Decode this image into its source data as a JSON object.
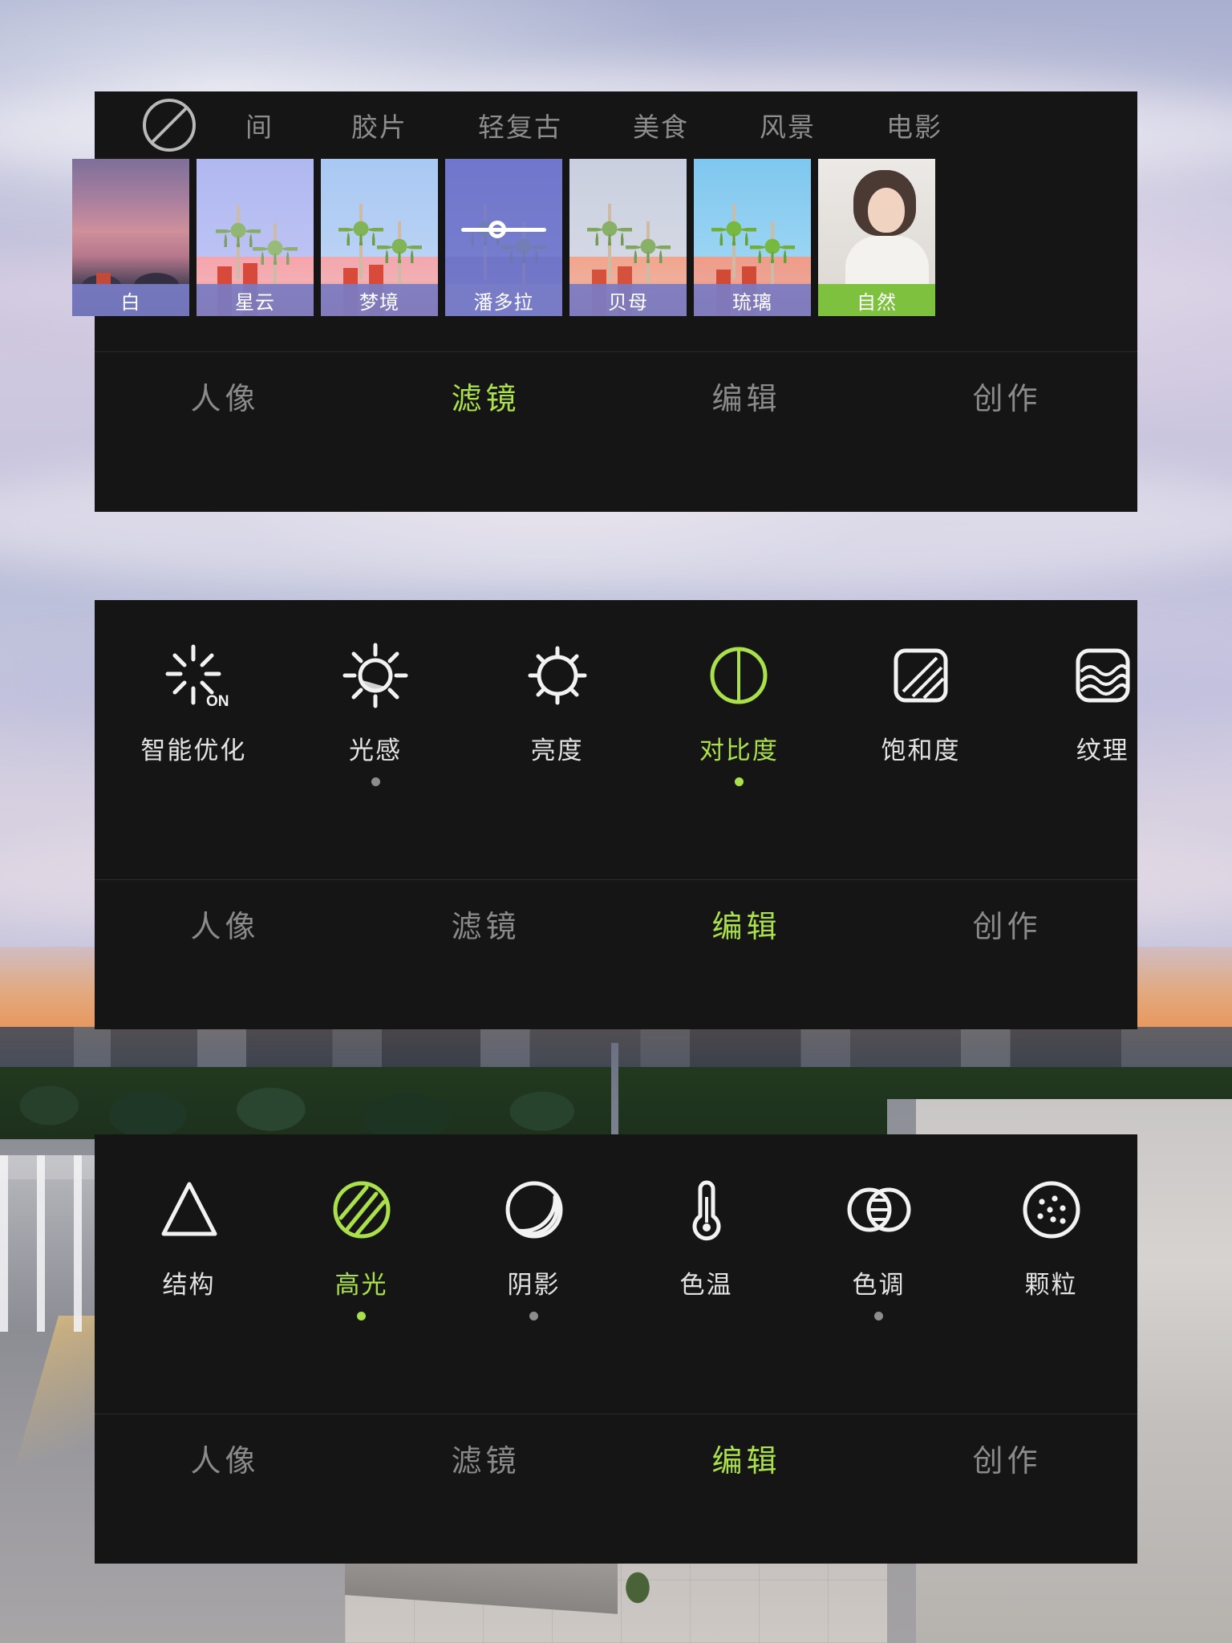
{
  "app": {
    "accent_green": "#a9e04c",
    "panel_bg": "#151515",
    "caption_violet": "#787cc4",
    "caption_green": "#7ec13f",
    "inactive_text": "#8a8a8a"
  },
  "filter_panel": {
    "no_filter_icon": "circle-slash-icon",
    "clipped_tab": "间",
    "category_tabs": [
      {
        "label": "胶片",
        "active": false
      },
      {
        "label": "轻复古",
        "active": false
      },
      {
        "label": "美食",
        "active": false
      },
      {
        "label": "风景",
        "active": false
      },
      {
        "label": "电影",
        "active": false
      }
    ],
    "filters": [
      {
        "label": "白",
        "selected": false,
        "clipped": true,
        "style": "sunset",
        "caption_style": "violet"
      },
      {
        "label": "星云",
        "selected": false,
        "clipped": false,
        "style": "palm-a",
        "caption_style": "violet"
      },
      {
        "label": "梦境",
        "selected": false,
        "clipped": false,
        "style": "palm-b",
        "caption_style": "violet"
      },
      {
        "label": "潘多拉",
        "selected": true,
        "clipped": false,
        "style": "palm-c",
        "caption_style": "violet"
      },
      {
        "label": "贝母",
        "selected": false,
        "clipped": false,
        "style": "palm-d",
        "caption_style": "violet"
      },
      {
        "label": "琉璃",
        "selected": false,
        "clipped": false,
        "style": "palm-e",
        "caption_style": "violet"
      },
      {
        "label": "自然",
        "selected": false,
        "clipped": true,
        "style": "portrait",
        "caption_style": "green"
      }
    ],
    "slider_value_percent": 40,
    "navbar": [
      {
        "label": "人像",
        "active": false
      },
      {
        "label": "滤镜",
        "active": true
      },
      {
        "label": "编辑",
        "active": false
      },
      {
        "label": "创作",
        "active": false
      }
    ]
  },
  "edit_panel_1": {
    "tools": [
      {
        "label": "智能优化",
        "icon": "auto-enhance-on-icon",
        "active": false,
        "dot": "none"
      },
      {
        "label": "光感",
        "icon": "exposure-sun-icon",
        "active": false,
        "dot": "grey"
      },
      {
        "label": "亮度",
        "icon": "brightness-sun-icon",
        "active": false,
        "dot": "none"
      },
      {
        "label": "对比度",
        "icon": "contrast-circle-icon",
        "active": true,
        "dot": "green"
      },
      {
        "label": "饱和度",
        "icon": "saturation-square-icon",
        "active": false,
        "dot": "none"
      },
      {
        "label": "纹理",
        "icon": "texture-wave-icon",
        "active": false,
        "dot": "none",
        "clipped": true
      }
    ],
    "navbar": [
      {
        "label": "人像",
        "active": false
      },
      {
        "label": "滤镜",
        "active": false
      },
      {
        "label": "编辑",
        "active": true
      },
      {
        "label": "创作",
        "active": false
      }
    ]
  },
  "edit_panel_2": {
    "tools": [
      {
        "label": "结构",
        "icon": "structure-triangle-icon",
        "active": false,
        "dot": "none"
      },
      {
        "label": "高光",
        "icon": "highlight-hatched-circle-icon",
        "active": true,
        "dot": "green"
      },
      {
        "label": "阴影",
        "icon": "shadow-moon-icon",
        "active": false,
        "dot": "grey"
      },
      {
        "label": "色温",
        "icon": "temperature-thermometer-icon",
        "active": false,
        "dot": "none"
      },
      {
        "label": "色调",
        "icon": "tint-venn-icon",
        "active": false,
        "dot": "grey"
      },
      {
        "label": "颗粒",
        "icon": "grain-dots-icon",
        "active": false,
        "dot": "none"
      }
    ],
    "navbar": [
      {
        "label": "人像",
        "active": false
      },
      {
        "label": "滤镜",
        "active": false
      },
      {
        "label": "编辑",
        "active": true
      },
      {
        "label": "创作",
        "active": false
      }
    ]
  }
}
